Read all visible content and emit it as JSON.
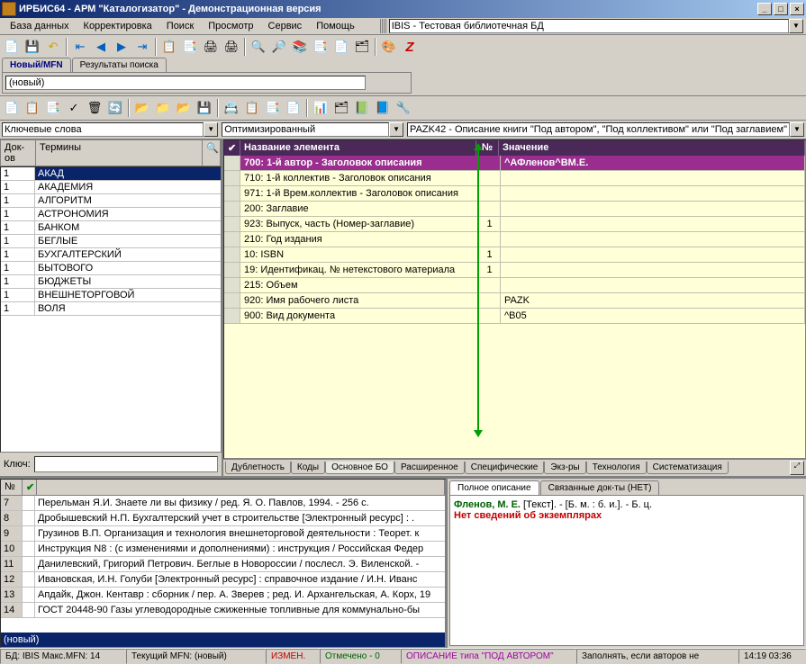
{
  "title": "ИРБИС64 - АРМ \"Каталогизатор\" - Демонстрационная версия",
  "titlebar": {
    "min": "_",
    "max": "□",
    "close": "×"
  },
  "menu": [
    "База данных",
    "Корректировка",
    "Поиск",
    "Просмотр",
    "Сервис",
    "Помощь"
  ],
  "db_selected": "IBIS - Тестовая библиотечная БД",
  "left": {
    "combo": "Ключевые слова",
    "header_doc": "Док-ов",
    "header_term": "Термины",
    "header_search": "🔍",
    "terms": [
      {
        "n": "1",
        "v": "АКАД"
      },
      {
        "n": "1",
        "v": "АКАДЕМИЯ"
      },
      {
        "n": "1",
        "v": "АЛГОРИТМ"
      },
      {
        "n": "1",
        "v": "АСТРОНОМИЯ"
      },
      {
        "n": "1",
        "v": "БАНКОМ"
      },
      {
        "n": "1",
        "v": "БЕГЛЫЕ"
      },
      {
        "n": "1",
        "v": "БУХГАЛТЕРСКИЙ"
      },
      {
        "n": "1",
        "v": "БЫТОВОГО"
      },
      {
        "n": "1",
        "v": "БЮДЖЕТЫ"
      },
      {
        "n": "1",
        "v": "ВНЕШНЕТОРГОВОЙ"
      },
      {
        "n": "1",
        "v": "ВОЛЯ"
      }
    ],
    "key_label": "Ключ:"
  },
  "right": {
    "tab_new": "Новый/MFN",
    "tab_results": "Результаты поиска",
    "new_value": "(новый)",
    "combo_opt": "Оптимизированный",
    "combo_pazk": "PAZK42 - Описание книги \"Под автором\", \"Под коллективом\" или \"Под заглавием\"",
    "hdr_name": "Название элемента",
    "hdr_num": "№",
    "hdr_val": "Значение",
    "rows": [
      {
        "name": "700: 1-й автор - Заголовок описания",
        "num": "",
        "val": "^АФленов^ВМ.Е.",
        "sel": true,
        "bold": true
      },
      {
        "name": "710: 1-й коллектив - Заголовок описания",
        "num": "",
        "val": ""
      },
      {
        "name": "971: 1-й Врем.коллектив - Заголовок описания",
        "num": "",
        "val": ""
      },
      {
        "name": "200: Заглавие",
        "num": "",
        "val": ""
      },
      {
        "name": "923: Выпуск, часть (Номер-заглавие)",
        "num": "1",
        "val": ""
      },
      {
        "name": "210: Год издания",
        "num": "",
        "val": ""
      },
      {
        "name": "10: ISBN",
        "num": "1",
        "val": ""
      },
      {
        "name": "19: Идентификац. № нетекстового материала",
        "num": "1",
        "val": ""
      },
      {
        "name": "215: Объем",
        "num": "",
        "val": ""
      },
      {
        "name": "920: Имя рабочего листа",
        "num": "",
        "val": "PAZK"
      },
      {
        "name": "900: Вид документа",
        "num": "",
        "val": "^B05"
      }
    ],
    "btabs": [
      "Дублетность",
      "Коды",
      "Основное БО",
      "Расширенное",
      "Специфические",
      "Экз-ры",
      "Технология",
      "Систематизация"
    ]
  },
  "lower_left": {
    "hdr_n": "№",
    "rows": [
      {
        "n": "7",
        "t": "Перельман Я.И. Знаете ли вы физику / ред. Я. О. Павлов, 1994. - 256 с."
      },
      {
        "n": "8",
        "t": "Дробышевский Н.П. Бухгалтерский учет в строительстве [Электронный ресурс] : ."
      },
      {
        "n": "9",
        "t": "Грузинов В.П. Организация и технология внешнеторговой деятельности : Теорет. к"
      },
      {
        "n": "10",
        "t": "Инструкция N8 : (с изменениями и дополнениями) : инструкция / Российская Федер"
      },
      {
        "n": "11",
        "t": "Данилевский, Григорий Петрович. Беглые в Новороссии / послесл. Э. Виленской. -"
      },
      {
        "n": "12",
        "t": "Ивановская, И.Н. Голуби [Электронный ресурс] : справочное издание / И.Н. Иванс"
      },
      {
        "n": "13",
        "t": "Апдайк, Джон. Кентавр : сборник / пер. А. Зверев ; ред. И. Архангельская, А. Корх, 19"
      },
      {
        "n": "14",
        "t": "ГОСТ 20448-90 Газы углеводородные сжиженные топливные для коммунально-бы"
      }
    ],
    "new_label": "(новый)"
  },
  "lower_right": {
    "tab_full": "Полное описание",
    "tab_linked": "Связанные док-ты (НЕТ)",
    "author": "Фленов, М. Е.",
    "rest": " [Текст]. - [Б. м. : б. и.]. - Б. ц.",
    "noinfo": "Нет сведений об экземплярах"
  },
  "status": {
    "bd": "БД: IBIS Макс.MFN: 14",
    "mfn": "Текущий MFN: (новый)",
    "izmen": "ИЗМЕН.",
    "marked": "Отмечено - 0",
    "desc": "ОПИСАНИЕ типа \"ПОД АВТОРОМ\"",
    "fill": "Заполнять, если авторов не",
    "time": "14:19  03:36"
  }
}
